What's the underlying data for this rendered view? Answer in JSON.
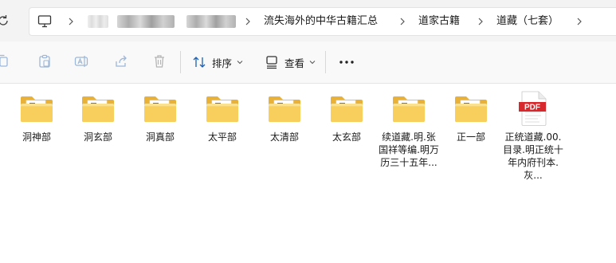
{
  "addressbar": {
    "breadcrumbs": [
      "流失海外的中华古籍汇总",
      "道家古籍",
      "道藏（七套）"
    ]
  },
  "toolbar": {
    "sort_label": "排序",
    "view_label": "查看"
  },
  "items": [
    {
      "label": "洞神部",
      "kind": "folder"
    },
    {
      "label": "洞玄部",
      "kind": "folder"
    },
    {
      "label": "洞真部",
      "kind": "folder"
    },
    {
      "label": "太平部",
      "kind": "folder"
    },
    {
      "label": "太清部",
      "kind": "folder"
    },
    {
      "label": "太玄部",
      "kind": "folder"
    },
    {
      "label": "续道藏.明.张国祥等编.明万历三十五年...",
      "kind": "folder"
    },
    {
      "label": "正一部",
      "kind": "folder"
    },
    {
      "label": "正统道藏.00.目录.明正统十年内府刊本.灰...",
      "kind": "pdf",
      "badge": "PDF"
    }
  ],
  "colors": {
    "folder_back": "#e8b23a",
    "folder_front": "#f8cf5c",
    "pdf_red": "#d7282d",
    "accent_blue": "#1a5fb4"
  }
}
